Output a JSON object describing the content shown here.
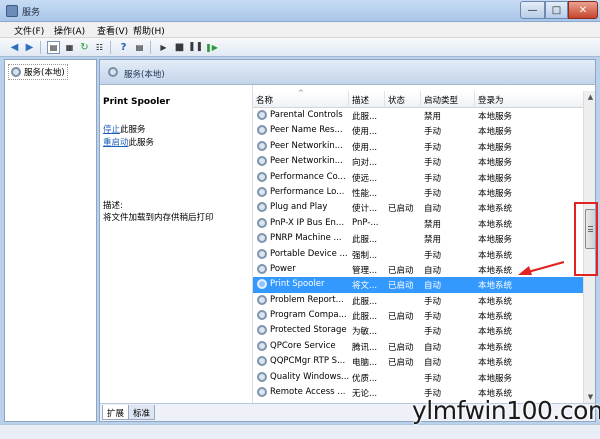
{
  "window": {
    "title": "服务"
  },
  "menu": [
    {
      "label": "文件(F)"
    },
    {
      "label": "操作(A)"
    },
    {
      "label": "查看(V)"
    },
    {
      "label": "帮助(H)"
    }
  ],
  "tree": {
    "root_label": "服务(本地)"
  },
  "header": {
    "title": "服务(本地)"
  },
  "detail": {
    "service_name": "Print Spooler",
    "stop_link": "停止",
    "stop_suffix": "此服务",
    "restart_link": "重启动",
    "restart_suffix": "此服务",
    "desc_label": "描述:",
    "desc_text": "将文件加载到内存供稍后打印"
  },
  "columns": [
    "名称",
    "描述",
    "状态",
    "启动类型",
    "登录为"
  ],
  "rows": [
    {
      "name": "Parental Controls",
      "desc": "此服...",
      "status": "",
      "startup": "禁用",
      "logon": "本地服务"
    },
    {
      "name": "Peer Name Res...",
      "desc": "使用...",
      "status": "",
      "startup": "手动",
      "logon": "本地服务"
    },
    {
      "name": "Peer Networkin...",
      "desc": "使用...",
      "status": "",
      "startup": "手动",
      "logon": "本地服务"
    },
    {
      "name": "Peer Networkin...",
      "desc": "向对...",
      "status": "",
      "startup": "手动",
      "logon": "本地服务"
    },
    {
      "name": "Performance Co...",
      "desc": "使远...",
      "status": "",
      "startup": "手动",
      "logon": "本地服务"
    },
    {
      "name": "Performance Lo...",
      "desc": "性能...",
      "status": "",
      "startup": "手动",
      "logon": "本地服务"
    },
    {
      "name": "Plug and Play",
      "desc": "使计...",
      "status": "已启动",
      "startup": "自动",
      "logon": "本地系统"
    },
    {
      "name": "PnP-X IP Bus En...",
      "desc": "PnP-...",
      "status": "",
      "startup": "禁用",
      "logon": "本地系统"
    },
    {
      "name": "PNRP Machine ...",
      "desc": "此服...",
      "status": "",
      "startup": "禁用",
      "logon": "本地服务"
    },
    {
      "name": "Portable Device ...",
      "desc": "强制...",
      "status": "",
      "startup": "手动",
      "logon": "本地系统"
    },
    {
      "name": "Power",
      "desc": "管理...",
      "status": "已启动",
      "startup": "自动",
      "logon": "本地系统"
    },
    {
      "name": "Print Spooler",
      "desc": "将文...",
      "status": "已启动",
      "startup": "自动",
      "logon": "本地系统",
      "selected": true
    },
    {
      "name": "Problem Report...",
      "desc": "此服...",
      "status": "",
      "startup": "手动",
      "logon": "本地系统"
    },
    {
      "name": "Program Compa...",
      "desc": "此服...",
      "status": "已启动",
      "startup": "手动",
      "logon": "本地系统"
    },
    {
      "name": "Protected Storage",
      "desc": "为敏...",
      "status": "",
      "startup": "手动",
      "logon": "本地系统"
    },
    {
      "name": "QPCore Service",
      "desc": "腾讯...",
      "status": "已启动",
      "startup": "自动",
      "logon": "本地系统"
    },
    {
      "name": "QQPCMgr RTP S...",
      "desc": "电脑...",
      "status": "已启动",
      "startup": "自动",
      "logon": "本地系统"
    },
    {
      "name": "Quality Windows...",
      "desc": "优质...",
      "status": "",
      "startup": "手动",
      "logon": "本地服务"
    },
    {
      "name": "Remote Access ...",
      "desc": "无论...",
      "status": "",
      "startup": "手动",
      "logon": "本地系统"
    }
  ],
  "tabs": [
    {
      "label": "扩展"
    },
    {
      "label": "标准"
    }
  ],
  "watermark": "ylmfwin100.com",
  "colors": {
    "selection": "#3399ff",
    "highlight": "#e32222",
    "link": "#1f5fb9"
  }
}
